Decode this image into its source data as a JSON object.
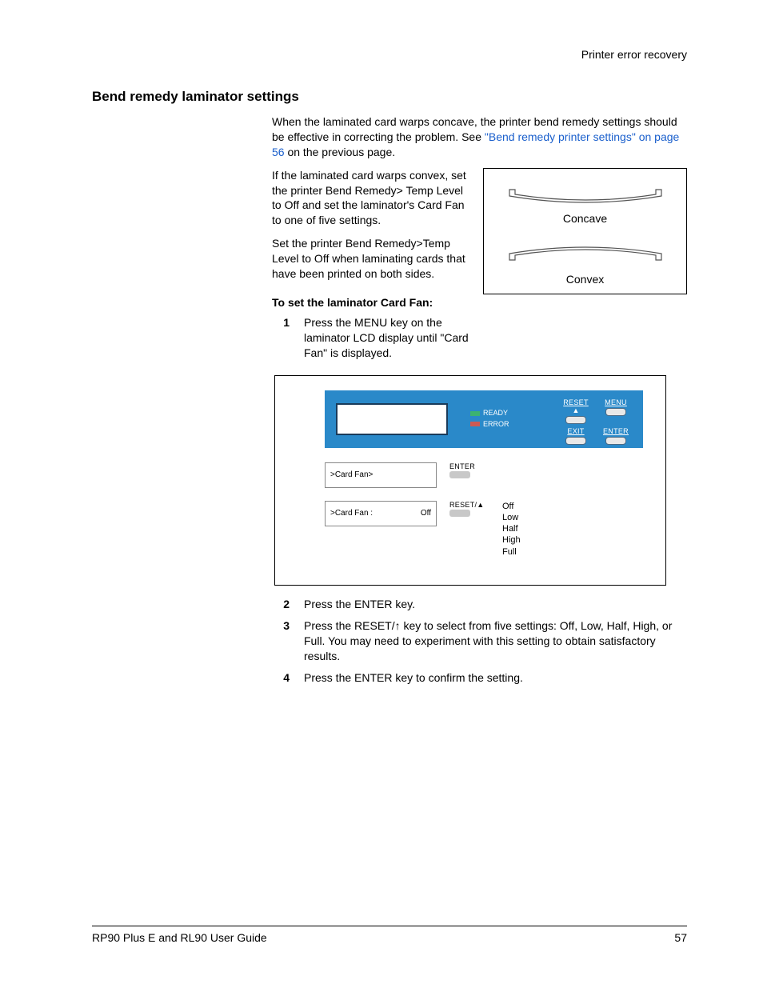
{
  "header": {
    "section": "Printer error recovery"
  },
  "heading": "Bend remedy laminator settings",
  "p1_a": "When the laminated card warps concave, the printer bend remedy settings should be effective in correcting the problem. See ",
  "p1_link": "\"Bend remedy printer settings\" on page 56",
  "p1_b": " on the previous page.",
  "p2": "If the laminated card warps convex, set the printer Bend Remedy> Temp Level to Off and set the laminator's Card Fan to one of five settings.",
  "p3": "Set the printer Bend Remedy>Temp Level to Off when laminating cards that have been printed on both sides.",
  "cards": {
    "concave": "Concave",
    "convex": "Convex"
  },
  "sub": "To set the laminator Card Fan:",
  "steps": {
    "n1": "1",
    "t1": "Press the MENU key on the laminator LCD display until \"Card Fan\" is displayed.",
    "n2": "2",
    "t2": "Press the ENTER key.",
    "n3": "3",
    "t3": "Press the RESET/↑ key to select from five settings: Off, Low, Half, High, or Full. You may need to experiment with this setting to obtain satisfactory results.",
    "n4": "4",
    "t4": "Press the ENTER key to confirm the setting."
  },
  "lcd": {
    "ready": "READY",
    "error": "ERROR",
    "reset": "RESET",
    "menu": "MENU",
    "exit": "EXIT",
    "enter": "ENTER",
    "arrow": "▲",
    "row1_left": ">Card Fan>",
    "row1_key": "ENTER",
    "row2_left": ">Card Fan :",
    "row2_right": "Off",
    "row2_key": "RESET/▲",
    "opts": [
      "Off",
      "Low",
      "Half",
      "High",
      "Full"
    ]
  },
  "footer": {
    "left": "RP90 Plus E and RL90 User Guide",
    "right": "57"
  }
}
